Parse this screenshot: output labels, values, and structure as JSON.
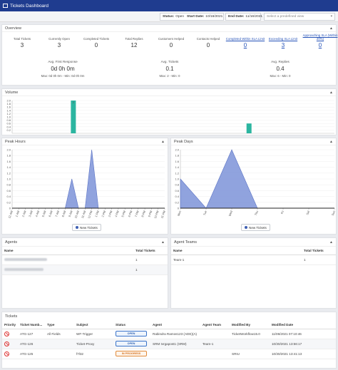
{
  "window": {
    "title": "Tickets Dashboard"
  },
  "filters": {
    "status_label": "Status:",
    "status_value": "Open",
    "start_label": "Start Date:",
    "start_value": "10/16/2021",
    "end_label": "End Date:",
    "end_value": "11/16/2021",
    "view_placeholder": "Select a predefined view"
  },
  "overview": {
    "title": "Overview",
    "stats": [
      {
        "label": "Total Tickets",
        "value": "3",
        "link": false
      },
      {
        "label": "Currently Open",
        "value": "3",
        "link": false
      },
      {
        "label": "Completed Tickets",
        "value": "0",
        "link": false
      },
      {
        "label": "Total Replies",
        "value": "12",
        "link": false
      },
      {
        "label": "Customers Helped",
        "value": "0",
        "link": false
      },
      {
        "label": "Contacts Helped",
        "value": "0",
        "link": false
      },
      {
        "label": "Completed Within SLA Limit",
        "value": "0",
        "link": true
      },
      {
        "label": "Exceeding SLA Limit",
        "value": "3",
        "link": true
      },
      {
        "label": "Approaching SLA (Within 20%)",
        "value": "0",
        "link": true
      }
    ],
    "averages": [
      {
        "label": "Avg. First Response",
        "value": "0d 0h 0m",
        "minmax": "Max: 0d 0h 0m - Min: 0d 0h 0m"
      },
      {
        "label": "Avg. Tickets",
        "value": "0.1",
        "minmax": "Max: 2 - Min: 0"
      },
      {
        "label": "Avg. Replies",
        "value": "0.4",
        "minmax": "Max: 6 - Min: 0"
      }
    ]
  },
  "volume": {
    "title": "Volume"
  },
  "peak_hours": {
    "title": "Peak Hours",
    "legend": "New Tickets"
  },
  "peak_days": {
    "title": "Peak Days",
    "legend": "New Tickets"
  },
  "agents": {
    "title": "Agents",
    "columns": [
      "Name",
      "Total Tickets"
    ],
    "rows": [
      {
        "name": "",
        "total": "1"
      },
      {
        "name": "",
        "total": "1"
      }
    ]
  },
  "agent_teams": {
    "title": "Agent Teams",
    "columns": [
      "Name",
      "Total Tickets"
    ],
    "rows": [
      {
        "name": "Team-1",
        "total": "1"
      }
    ]
  },
  "tickets": {
    "title": "Tickets",
    "columns": [
      "Priority",
      "Ticket Numb...",
      "Type",
      "Subject",
      "Status",
      "Agent",
      "Agent Team",
      "Modified By",
      "Modified Date"
    ],
    "rows": [
      {
        "number": "ATG-127",
        "type": "All Fields",
        "subject": "WF-Trigger",
        "status": "OPEN",
        "agent": "Rabindra Ramos123 (ADE)(A)",
        "team": "",
        "modified_by": "TicketWorkflow15.0",
        "date": "11/06/2021 07:10:46"
      },
      {
        "number": "ATG-126",
        "type": "",
        "subject": "Ticket-Proxy",
        "status": "OPEN",
        "agent": "SRM Ivrgapost1 (SRM)",
        "team": "Team-1",
        "modified_by": "",
        "date": "10/30/2021 13:56:17"
      },
      {
        "number": "ATG-125",
        "type": "",
        "subject": "f7l32",
        "status": "IN PROGRESS",
        "agent": "",
        "team": "",
        "modified_by": "SRIU",
        "date": "10/30/2021 13:41:13"
      }
    ]
  },
  "chart_data": [
    {
      "type": "bar",
      "title": "Volume",
      "ylim": [
        0,
        2
      ],
      "yticks": [
        "2.0",
        "1.8",
        "1.6",
        "1.4",
        "1.2",
        "1.0",
        "0.8",
        "0.6",
        "0.4",
        "0.2"
      ],
      "bars": [
        {
          "position": 0.19,
          "value": 2,
          "label": "2"
        },
        {
          "position": 0.735,
          "value": 0.6
        }
      ],
      "color": "#2bb5a0"
    },
    {
      "type": "area",
      "title": "Peak Hours",
      "categories": [
        "12 AM",
        "1 AM",
        "2 AM",
        "3 AM",
        "4 AM",
        "5 AM",
        "6 AM",
        "7 AM",
        "8 AM",
        "9 AM",
        "10 AM",
        "11 AM",
        "12 PM",
        "1 PM",
        "2 PM",
        "3 PM",
        "4 PM",
        "5 PM",
        "6 PM",
        "7 PM",
        "8 PM",
        "9 PM",
        "10 PM",
        "11 PM"
      ],
      "series": [
        {
          "name": "New Tickets",
          "values": [
            0,
            0,
            0,
            0,
            0,
            0,
            0,
            0,
            0,
            1,
            0,
            0,
            2,
            0,
            0,
            0,
            0,
            0,
            0,
            0,
            0,
            0,
            0,
            0
          ]
        }
      ],
      "ylim": [
        0,
        2
      ],
      "yticks": [
        "2.0",
        "1.8",
        "1.6",
        "1.4",
        "1.2",
        "1.0",
        "0.8",
        "0.6",
        "0.4",
        "0.2",
        "0"
      ],
      "color": "#7d93d8"
    },
    {
      "type": "area",
      "title": "Peak Days",
      "categories": [
        "Mon",
        "Tue",
        "Wed",
        "Thu",
        "Fri",
        "Sat",
        "Sun"
      ],
      "series": [
        {
          "name": "New Tickets",
          "values": [
            1,
            0,
            2,
            0,
            0,
            0,
            0
          ]
        }
      ],
      "ylim": [
        0,
        2
      ],
      "yticks": [
        "2.0",
        "1.8",
        "1.6",
        "1.4",
        "1.2",
        "1.0",
        "0.8",
        "0.6",
        "0.4",
        "0.2",
        "0"
      ],
      "color": "#7d93d8"
    }
  ]
}
